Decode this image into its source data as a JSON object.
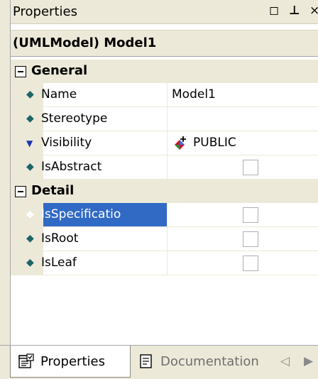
{
  "panel": {
    "title": "Properties",
    "buttons": {
      "float": "◻",
      "pin": "⊥",
      "close": "×"
    }
  },
  "object_title": "(UMLModel) Model1",
  "categories": [
    {
      "label": "General",
      "rows": [
        {
          "icon": "diamond-icon",
          "name": "Name",
          "value": "Model1"
        },
        {
          "icon": "diamond-icon",
          "name": "Stereotype",
          "value": ""
        },
        {
          "icon": "triangle-down-icon",
          "name": "Visibility",
          "value": "PUBLIC"
        },
        {
          "icon": "diamond-icon",
          "name": "IsAbstract",
          "value": "unchecked"
        }
      ]
    },
    {
      "label": "Detail",
      "rows": [
        {
          "icon": "diamond-icon",
          "name": "IsSpecificatio",
          "value": "unchecked",
          "selected": true
        },
        {
          "icon": "diamond-icon",
          "name": "IsRoot",
          "value": "unchecked"
        },
        {
          "icon": "diamond-icon",
          "name": "IsLeaf",
          "value": "unchecked"
        }
      ]
    }
  ],
  "glyphs": {
    "diamond": "◆",
    "triangle": "▼",
    "prev": "◁",
    "next": "▶"
  },
  "tabs": [
    {
      "label": "Properties",
      "active": true
    },
    {
      "label": "Documentation",
      "active": false
    }
  ],
  "colors": {
    "selection": "#316ac5",
    "chrome": "#ece9d8"
  }
}
